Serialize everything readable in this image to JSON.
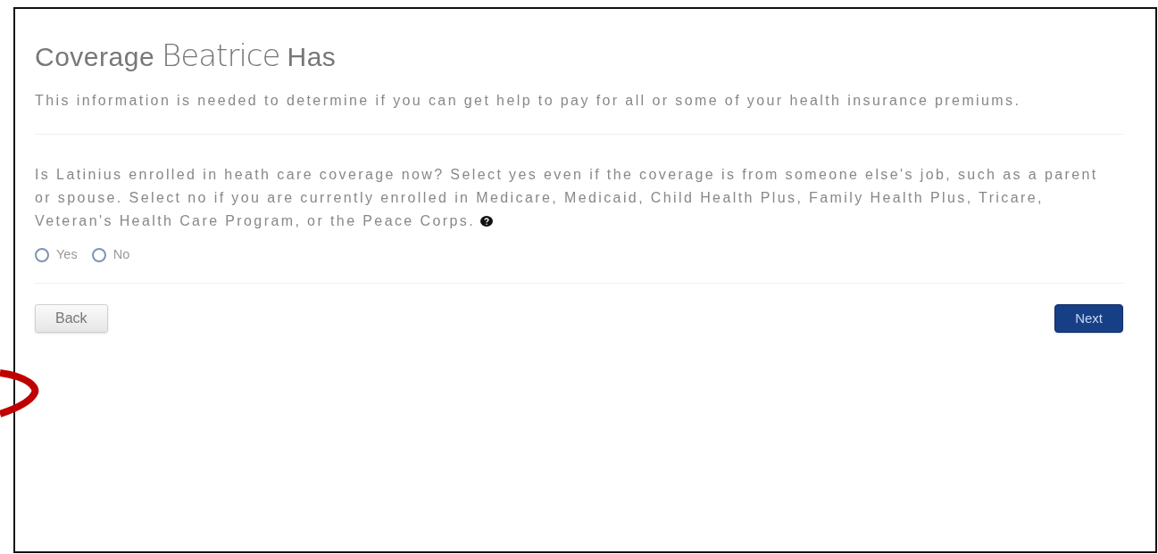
{
  "heading": {
    "prefix": "Coverage",
    "name": "Beatrice",
    "suffix": "Has"
  },
  "intro": "This information is needed to determine if you can get help to pay for all or some of your health insurance premiums.",
  "question": "Is Latinius enrolled in heath care coverage now? Select yes even if the coverage is from someone else's job, such as a parent or spouse. Select no if you are currently enrolled in Medicare, Medicaid, Child Health Plus, Family Health Plus, Tricare, Veteran's Health Care Program, or the Peace Corps.",
  "options": [
    {
      "label": "Yes",
      "selected": false
    },
    {
      "label": "No",
      "selected": false
    }
  ],
  "buttons": [
    {
      "label": "Back",
      "kind": "secondary"
    },
    {
      "label": "Next",
      "kind": "primary"
    }
  ]
}
